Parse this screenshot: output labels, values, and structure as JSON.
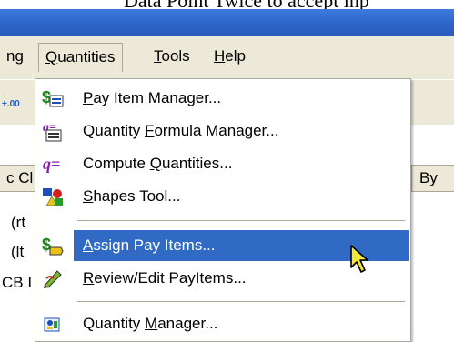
{
  "document": {
    "partial_text": "Data Point Twice to accept inp"
  },
  "menubar": {
    "items": [
      {
        "label_pre": "",
        "label_ul": "",
        "label_post": "ng"
      },
      {
        "label_pre": "",
        "label_ul": "Q",
        "label_post": "uantities"
      },
      {
        "label_pre": "",
        "label_ul": "T",
        "label_post": "ools"
      },
      {
        "label_pre": "",
        "label_ul": "H",
        "label_post": "elp"
      }
    ]
  },
  "toolbar": {
    "icon": "decimal-format-icon",
    "icon_top": "←",
    "icon_bottom": "+.00"
  },
  "background": {
    "column_header_left": "c Cl",
    "column_header_right": "By",
    "rows": [
      "(rt",
      "(lt",
      "CB I"
    ]
  },
  "dropdown": {
    "items": [
      {
        "icon": "pay-item-manager-icon",
        "label_pre": "",
        "label_ul": "P",
        "label_post": "ay Item Manager...",
        "highlighted": false
      },
      {
        "icon": "quantity-formula-manager-icon",
        "label_pre": "Quantity ",
        "label_ul": "F",
        "label_post": "ormula Manager...",
        "highlighted": false
      },
      {
        "icon": "compute-quantities-icon",
        "label_pre": "Compute ",
        "label_ul": "Q",
        "label_post": "uantities...",
        "highlighted": false
      },
      {
        "icon": "shapes-tool-icon",
        "label_pre": "",
        "label_ul": "S",
        "label_post": "hapes Tool...",
        "highlighted": false
      },
      {
        "icon": "assign-pay-items-icon",
        "label_pre": "",
        "label_ul": "A",
        "label_post": "ssign Pay Items...",
        "highlighted": true
      },
      {
        "icon": "review-edit-payitems-icon",
        "label_pre": "",
        "label_ul": "R",
        "label_post": "eview/Edit PayItems...",
        "highlighted": false
      },
      {
        "icon": "quantity-manager-icon",
        "label_pre": "Quantity ",
        "label_ul": "M",
        "label_post": "anager...",
        "highlighted": false
      }
    ]
  },
  "colors": {
    "highlight": "#316ac5",
    "menu_bg": "#ece9d8",
    "titlebar": "#2d63c8"
  }
}
